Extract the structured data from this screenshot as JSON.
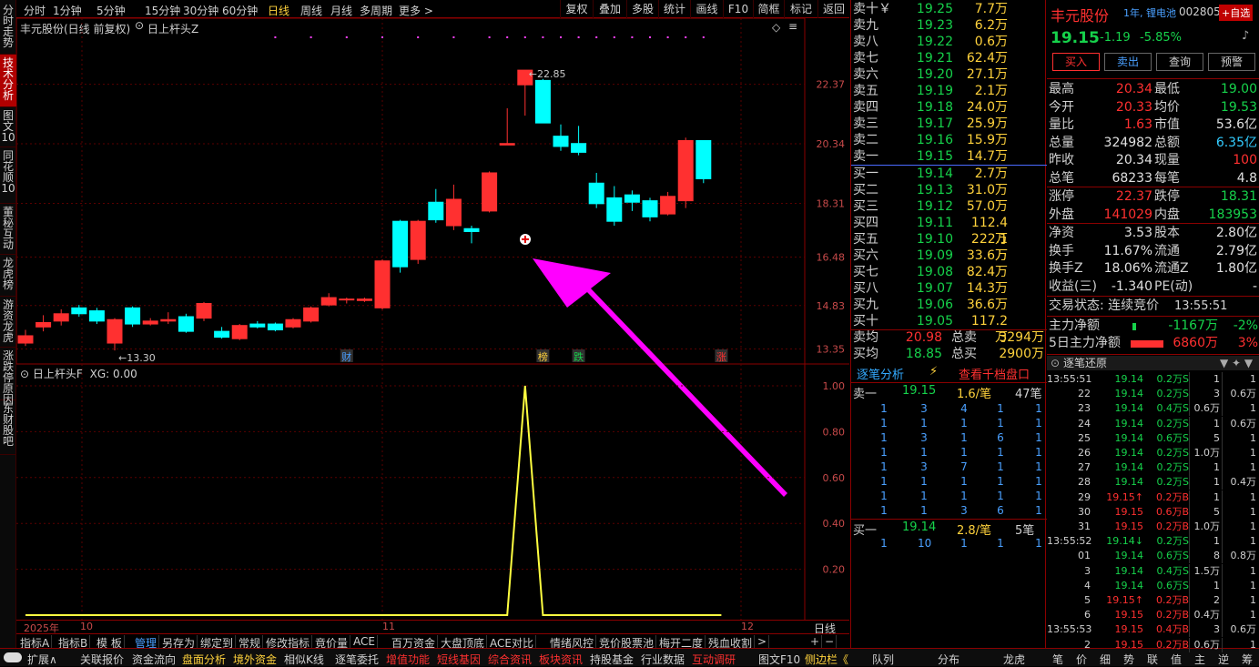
{
  "left_sidebar": [
    "分时走势",
    "技术分析",
    "图文10",
    "同花顺10",
    "董秘互动",
    "龙虎榜",
    "游资龙虎",
    "涨跌停原因",
    "东财股吧"
  ],
  "periods": [
    "分时",
    "1分钟",
    "5分钟",
    "15分钟",
    "30分钟",
    "60分钟",
    "日线",
    "周线",
    "月线",
    "多周期",
    "更多 >"
  ],
  "toolbar": [
    "复权",
    "叠加",
    "多股",
    "统计",
    "画线",
    "F10",
    "简框",
    "标记",
    "返回"
  ],
  "chart_title": {
    "name": "丰元股份(日线 前复权)",
    "indicator": "日上杆头Z",
    "diamond": "◇",
    "menu": "≡"
  },
  "price_axis": [
    "22.37",
    "20.34",
    "18.31",
    "16.48",
    "14.83",
    "13.35"
  ],
  "annotations": {
    "high": "22.85",
    "low": "13.30",
    "flags": [
      "财",
      "榜",
      "跌",
      "涨"
    ]
  },
  "chart_data": [
    {
      "type": "candlestick",
      "xlabel": "",
      "ylabel": "",
      "ylim": [
        12.9,
        24.0
      ],
      "candles": [
        {
          "o": 13.55,
          "c": 13.8,
          "h": 14.0,
          "l": 13.45
        },
        {
          "o": 14.1,
          "c": 14.25,
          "h": 14.5,
          "l": 13.95
        },
        {
          "o": 14.3,
          "c": 14.55,
          "h": 14.7,
          "l": 14.15
        },
        {
          "o": 14.75,
          "c": 14.55,
          "h": 14.85,
          "l": 14.45
        },
        {
          "o": 14.65,
          "c": 14.3,
          "h": 14.75,
          "l": 14.2
        },
        {
          "o": 13.55,
          "c": 14.35,
          "h": 14.4,
          "l": 13.3
        },
        {
          "o": 14.75,
          "c": 14.2,
          "h": 14.8,
          "l": 14.1
        },
        {
          "o": 14.2,
          "c": 14.3,
          "h": 14.4,
          "l": 14.15
        },
        {
          "o": 14.3,
          "c": 14.35,
          "h": 14.6,
          "l": 14.2
        },
        {
          "o": 14.45,
          "c": 13.95,
          "h": 14.55,
          "l": 13.9
        },
        {
          "o": 14.4,
          "c": 14.9,
          "h": 14.95,
          "l": 14.3
        },
        {
          "o": 13.95,
          "c": 13.75,
          "h": 14.1,
          "l": 13.7
        },
        {
          "o": 13.7,
          "c": 14.15,
          "h": 14.2,
          "l": 13.65
        },
        {
          "o": 14.2,
          "c": 14.1,
          "h": 14.3,
          "l": 14.05
        },
        {
          "o": 14.2,
          "c": 14.0,
          "h": 14.25,
          "l": 13.95
        },
        {
          "o": 14.1,
          "c": 14.35,
          "h": 14.4,
          "l": 14.05
        },
        {
          "o": 14.3,
          "c": 14.75,
          "h": 14.8,
          "l": 14.25
        },
        {
          "o": 14.85,
          "c": 15.1,
          "h": 15.25,
          "l": 14.8
        },
        {
          "o": 15.05,
          "c": 15.05,
          "h": 15.1,
          "l": 14.9
        },
        {
          "o": 15.0,
          "c": 15.05,
          "h": 15.1,
          "l": 14.95
        },
        {
          "o": 14.75,
          "c": 16.35,
          "h": 16.4,
          "l": 14.7
        },
        {
          "o": 17.7,
          "c": 16.15,
          "h": 17.75,
          "l": 15.95
        },
        {
          "o": 16.4,
          "c": 17.7,
          "h": 17.75,
          "l": 16.25
        },
        {
          "o": 18.35,
          "c": 17.75,
          "h": 18.8,
          "l": 17.65
        },
        {
          "o": 17.55,
          "c": 18.45,
          "h": 18.95,
          "l": 17.4
        },
        {
          "o": 17.45,
          "c": 17.35,
          "h": 17.55,
          "l": 16.95
        },
        {
          "o": 18.05,
          "c": 19.35,
          "h": 19.4,
          "l": 18.0
        },
        {
          "o": 20.3,
          "c": 20.35,
          "h": 21.55,
          "l": 20.3
        },
        {
          "o": 22.35,
          "c": 22.85,
          "h": 22.85,
          "l": 21.3
        },
        {
          "o": 22.5,
          "c": 21.05,
          "h": 22.55,
          "l": 21.05
        },
        {
          "o": 20.6,
          "c": 20.25,
          "h": 21.0,
          "l": 20.1
        },
        {
          "o": 20.35,
          "c": 20.05,
          "h": 20.95,
          "l": 19.95
        },
        {
          "o": 19.0,
          "c": 18.3,
          "h": 19.35,
          "l": 18.15
        },
        {
          "o": 18.5,
          "c": 17.7,
          "h": 18.9,
          "l": 17.55
        },
        {
          "o": 18.6,
          "c": 18.35,
          "h": 18.75,
          "l": 18.05
        },
        {
          "o": 18.4,
          "c": 17.85,
          "h": 18.5,
          "l": 17.7
        },
        {
          "o": 17.95,
          "c": 18.55,
          "h": 18.7,
          "l": 17.9
        },
        {
          "o": 18.4,
          "c": 20.45,
          "h": 20.55,
          "l": 18.15
        },
        {
          "o": 20.45,
          "c": 19.15,
          "h": 20.45,
          "l": 19.0
        }
      ]
    },
    {
      "type": "line",
      "series": [
        {
          "values": [
            0,
            0,
            0,
            0,
            0,
            0,
            0,
            0,
            0,
            0,
            0,
            0,
            0,
            0,
            0,
            0,
            0,
            0,
            0,
            0,
            0,
            0,
            0,
            0,
            0,
            0,
            0,
            0,
            1,
            0,
            0,
            0,
            0,
            0,
            0,
            0,
            0,
            0,
            0,
            0
          ]
        }
      ],
      "ylim": [
        0,
        1.0
      ]
    }
  ],
  "idx_title": {
    "name": "日上杆头F",
    "xg": "XG: 0.00"
  },
  "idx_axis": [
    "1.00",
    "0.80",
    "0.60",
    "0.40",
    "0.20"
  ],
  "date_axis": {
    "year": "2025年",
    "m10": "10",
    "m11": "11",
    "m12": "12",
    "period": "日线"
  },
  "tabs_row": [
    "指标A",
    "指标B",
    "模 板",
    "管理",
    "另存为",
    "绑定到",
    "常规",
    "修改指标",
    "竟价量",
    "ACE",
    "百万资金",
    "大盘顶底",
    "ACE对比",
    "情绪风控",
    "竞价股票池",
    "梅开二度",
    "残血收割",
    ">",
    "+",
    "−"
  ],
  "bottom_bar": [
    {
      "t": "扩展∧",
      "c": "n"
    },
    {
      "t": "关联报价",
      "c": "n"
    },
    {
      "t": "资金流向",
      "c": "n"
    },
    {
      "t": "盘面分析",
      "c": "g"
    },
    {
      "t": "境外资金",
      "c": "g"
    },
    {
      "t": "相似K线",
      "c": "n"
    },
    {
      "t": "逐笔委托",
      "c": "n"
    },
    {
      "t": "增值功能",
      "c": "r"
    },
    {
      "t": "短线基因",
      "c": "r"
    },
    {
      "t": "综合资讯",
      "c": "r"
    },
    {
      "t": "板块资讯",
      "c": "r"
    },
    {
      "t": "持股基金",
      "c": "n"
    },
    {
      "t": "行业数据",
      "c": "n"
    },
    {
      "t": "互动调研",
      "c": "r"
    },
    {
      "t": "图文F10",
      "c": "n"
    },
    {
      "t": "侧边栏《",
      "c": "g"
    },
    {
      "t": "队列",
      "c": "n"
    },
    {
      "t": "分布",
      "c": "n"
    },
    {
      "t": "龙虎",
      "c": "n"
    },
    {
      "t": "笔",
      "c": "n"
    },
    {
      "t": "价",
      "c": "n"
    },
    {
      "t": "细",
      "c": "n"
    },
    {
      "t": "势",
      "c": "n"
    },
    {
      "t": "联",
      "c": "n"
    },
    {
      "t": "值",
      "c": "n"
    },
    {
      "t": "主",
      "c": "n"
    },
    {
      "t": "逆",
      "c": "n"
    },
    {
      "t": "筹",
      "c": "n"
    }
  ],
  "order_book": {
    "asks": [
      [
        "卖十￥",
        "19.25",
        "7.7万"
      ],
      [
        "卖九",
        "19.23",
        "6.2万"
      ],
      [
        "卖八",
        "19.22",
        "0.6万"
      ],
      [
        "卖七",
        "19.21",
        "62.4万"
      ],
      [
        "卖六",
        "19.20",
        "27.1万"
      ],
      [
        "卖五",
        "19.19",
        "2.1万"
      ],
      [
        "卖四",
        "19.18",
        "24.0万"
      ],
      [
        "卖三",
        "19.17",
        "25.9万"
      ],
      [
        "卖二",
        "19.16",
        "15.9万"
      ],
      [
        "卖一",
        "19.15",
        "14.7万"
      ]
    ],
    "bids": [
      [
        "买一",
        "19.14",
        "2.7万"
      ],
      [
        "买二",
        "19.13",
        "31.0万"
      ],
      [
        "买三",
        "19.12",
        "57.0万"
      ],
      [
        "买四",
        "19.11",
        "112.4万"
      ],
      [
        "买五",
        "19.10",
        "222.1万"
      ],
      [
        "买六",
        "19.09",
        "33.6万"
      ],
      [
        "买七",
        "19.08",
        "82.4万"
      ],
      [
        "买八",
        "19.07",
        "14.3万"
      ],
      [
        "买九",
        "19.06",
        "36.6万"
      ],
      [
        "买十",
        "19.05",
        "117.2万"
      ]
    ],
    "summary": [
      [
        "卖均",
        "20.98",
        "总卖",
        "3294万"
      ],
      [
        "买均",
        "18.85",
        "总买",
        "2900万"
      ]
    ]
  },
  "tick_analysis": {
    "title": "逐笔分析",
    "link": "查看千档盘口",
    "sell_label": "卖一",
    "sell_price": "19.15",
    "sell_avg": "1.6/笔",
    "sell_count": "47笔",
    "sell_grid": [
      [
        "1",
        "3",
        "4",
        "1",
        "1"
      ],
      [
        "1",
        "1",
        "1",
        "1",
        "1"
      ],
      [
        "1",
        "3",
        "1",
        "6",
        "1"
      ],
      [
        "1",
        "1",
        "1",
        "1",
        "1"
      ],
      [
        "1",
        "3",
        "7",
        "1",
        "1"
      ],
      [
        "1",
        "1",
        "1",
        "1",
        "1"
      ],
      [
        "1",
        "1",
        "1",
        "1",
        "1"
      ],
      [
        "1",
        "1",
        "3",
        "6",
        "1"
      ]
    ],
    "buy_label": "买一",
    "buy_price": "19.14",
    "buy_avg": "2.8/笔",
    "buy_count": "5笔",
    "buy_grid": [
      [
        "1",
        "10",
        "1",
        "1",
        "1"
      ]
    ]
  },
  "quote": {
    "name": "丰元股份",
    "tag": "1年, 锂电池",
    "code": "002805",
    "add": "+自选",
    "price": "19.15",
    "change": "-1.19",
    "pct": "-5.85%",
    "buttons": [
      "买入",
      "卖出",
      "查询",
      "预警"
    ],
    "stats": [
      [
        "最高",
        "20.34",
        "最低",
        "19.00"
      ],
      [
        "今开",
        "20.33",
        "均价",
        "19.53"
      ],
      [
        "量比",
        "1.63",
        "市值",
        "53.6亿"
      ],
      [
        "总量",
        "324982",
        "总额",
        "6.35亿"
      ],
      [
        "昨收",
        "20.34",
        "现量",
        "100"
      ],
      [
        "总笔",
        "68233",
        "每笔",
        "4.8"
      ],
      [
        "涨停",
        "22.37",
        "跌停",
        "18.31"
      ],
      [
        "外盘",
        "141029",
        "内盘",
        "183953"
      ],
      [
        "净资",
        "3.53",
        "股本",
        "2.80亿"
      ],
      [
        "换手",
        "11.67%",
        "流通",
        "2.79亿"
      ],
      [
        "换手Z",
        "18.06%",
        "流通Z",
        "1.80亿"
      ],
      [
        "收益(三)",
        "-1.340",
        "PE(动)",
        "-"
      ]
    ],
    "trade_status": "交易状态: 连续竞价",
    "trade_time": "13:55:51",
    "main_flow": {
      "label": "主力净额",
      "value": "-1167万",
      "pct": "-2%"
    },
    "flow5": {
      "label": "5日主力净额",
      "value": "6860万",
      "pct": "3%"
    },
    "tick_title": "逐笔还原"
  },
  "ticks": [
    [
      "13:55:51",
      "19.14",
      "0.2万S",
      "1",
      "1"
    ],
    [
      "22",
      "19.14",
      "0.2万S",
      "3",
      "0.6万"
    ],
    [
      "23",
      "19.14",
      "0.4万S",
      "0.6万",
      "1"
    ],
    [
      "24",
      "19.14",
      "0.2万S",
      "1",
      "0.6万"
    ],
    [
      "25",
      "19.14",
      "0.6万S",
      "5",
      "1"
    ],
    [
      "26",
      "19.14",
      "0.2万S",
      "1.0万",
      "1"
    ],
    [
      "27",
      "19.14",
      "0.2万S",
      "1",
      "1"
    ],
    [
      "28",
      "19.14",
      "0.2万S",
      "1",
      "0.4万"
    ],
    [
      "29",
      "19.15↑",
      "0.2万B",
      "1",
      "1"
    ],
    [
      "30",
      "19.15",
      "0.6万B",
      "5",
      "1"
    ],
    [
      "31",
      "19.15",
      "0.2万B",
      "1.0万",
      "1"
    ],
    [
      "13:55:52",
      "19.14↓",
      "0.2万S",
      "1",
      "1"
    ],
    [
      "01",
      "19.14",
      "0.6万S",
      "8",
      "0.8万"
    ],
    [
      "3",
      "19.14",
      "0.4万S",
      "1.5万",
      "1"
    ],
    [
      "4",
      "19.14",
      "0.6万S",
      "1",
      "1"
    ],
    [
      "5",
      "19.15↑",
      "0.2万B",
      "2",
      "1"
    ],
    [
      "6",
      "19.15",
      "0.2万B",
      "0.4万",
      "1"
    ],
    [
      "13:55:53",
      "19.15",
      "0.4万B",
      "3",
      "0.6万"
    ],
    [
      "2",
      "19.15",
      "0.2万B",
      "0.6万",
      "1"
    ]
  ],
  "colors": {
    "up": "#ff3030",
    "down": "#00ffff",
    "accent": "#ffd23c",
    "grid": "#8b0000",
    "arrow": "#ff00ff"
  }
}
